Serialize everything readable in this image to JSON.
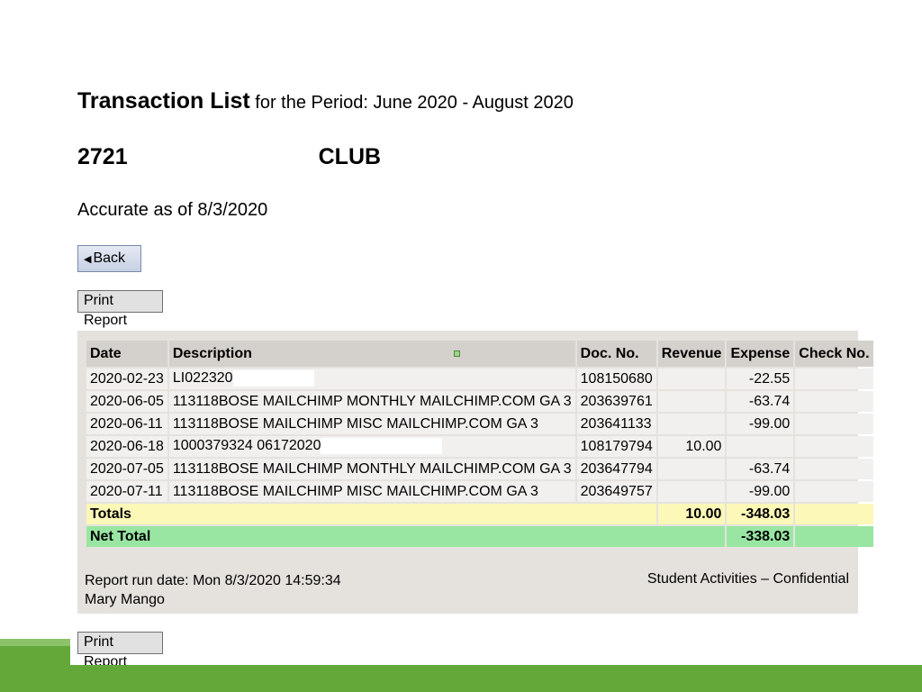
{
  "report": {
    "title_bold": "Transaction List",
    "title_rest": "for the Period: June 2020 - August 2020",
    "club_left": "2721",
    "club_right": "CLUB",
    "accurate_as_of": "Accurate as of 8/3/2020",
    "back_label": "Back",
    "print_label": "Print Report"
  },
  "table": {
    "headers": {
      "date": "Date",
      "description": "Description",
      "doc_no": "Doc. No.",
      "revenue": "Revenue",
      "expense": "Expense",
      "check_no": "Check No."
    },
    "rows": [
      {
        "date": "2020-02-23",
        "description": "LI022320",
        "doc_no": "108150680",
        "revenue": "",
        "expense": "-22.55",
        "check_no": ""
      },
      {
        "date": "2020-06-05",
        "description": "113118BOSE MAILCHIMP MONTHLY MAILCHIMP.COM GA 3",
        "doc_no": "203639761",
        "revenue": "",
        "expense": "-63.74",
        "check_no": ""
      },
      {
        "date": "2020-06-11",
        "description": "113118BOSE MAILCHIMP MISC MAILCHIMP.COM GA 3",
        "doc_no": "203641133",
        "revenue": "",
        "expense": "-99.00",
        "check_no": ""
      },
      {
        "date": "2020-06-18",
        "description": "1000379324 06172020",
        "doc_no": "108179794",
        "revenue": "10.00",
        "expense": "",
        "check_no": ""
      },
      {
        "date": "2020-07-05",
        "description": "113118BOSE MAILCHIMP MONTHLY MAILCHIMP.COM GA 3",
        "doc_no": "203647794",
        "revenue": "",
        "expense": "-63.74",
        "check_no": ""
      },
      {
        "date": "2020-07-11",
        "description": "113118BOSE MAILCHIMP MISC MAILCHIMP.COM GA 3",
        "doc_no": "203649757",
        "revenue": "",
        "expense": "-99.00",
        "check_no": ""
      }
    ],
    "totals": {
      "label": "Totals",
      "revenue": "10.00",
      "expense": "-348.03"
    },
    "net_total": {
      "label": "Net Total",
      "expense": "-338.03"
    }
  },
  "footer": {
    "run_date": "Report run date: Mon 8/3/2020 14:59:34",
    "run_by": "Mary Mango",
    "confidential": "Student Activities – Confidential"
  },
  "colors": {
    "panel": "#e5e2de",
    "totals_row": "#fbf8b8",
    "net_total_row": "#99e6a3",
    "accent_green": "#64a83a"
  }
}
